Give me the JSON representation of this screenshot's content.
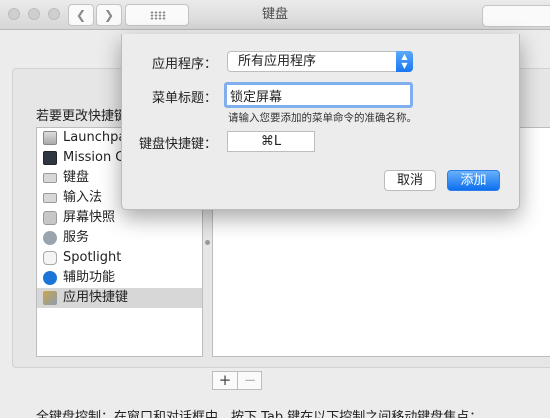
{
  "window": {
    "title": "键盘"
  },
  "icons": {
    "back": "chevron-left-icon",
    "forward": "chevron-right-icon",
    "show_all": "grid-icon",
    "popup": "up-down-arrows-icon"
  },
  "colors": {
    "accent": "#1a77f2",
    "focus_ring": "#7fb0ed"
  },
  "pane": {
    "instruction": "若要更改快捷键",
    "categories": [
      {
        "label": "Launchpad"
      },
      {
        "label": "Mission Control"
      },
      {
        "label": "键盘"
      },
      {
        "label": "输入法"
      },
      {
        "label": "屏幕快照"
      },
      {
        "label": "服务"
      },
      {
        "label": "Spotlight"
      },
      {
        "label": "辅助功能"
      },
      {
        "label": "应用快捷键",
        "selected": true
      }
    ],
    "add_label": "+",
    "remove_label": "−",
    "footer": "全键盘控制：在窗口和对话框中，按下 Tab 键在以下控制之间移动键盘焦点："
  },
  "sheet": {
    "app_label": "应用程序：",
    "app_value": "所有应用程序",
    "menu_title_label": "菜单标题：",
    "menu_title_value": "锁定屏幕",
    "hint": "请输入您要添加的菜单命令的准确名称。",
    "shortcut_label": "键盘快捷键：",
    "shortcut_value": "⌘L",
    "cancel_label": "取消",
    "add_label": "添加"
  }
}
